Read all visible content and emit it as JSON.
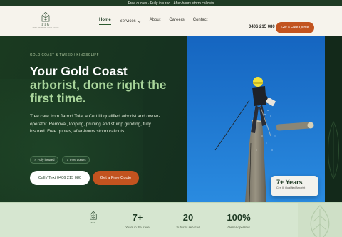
{
  "topbar": {
    "text": "Free quotes · Fully insured · After-hours storm callouts"
  },
  "brand": {
    "name": "TTG",
    "tagline": "TREE TRIMMING GOLD COAST",
    "icon": "tree-logo-icon"
  },
  "nav": {
    "items": [
      {
        "label": "Home",
        "active": true
      },
      {
        "label": "Services",
        "has_dropdown": true
      },
      {
        "label": "About"
      },
      {
        "label": "Careers"
      },
      {
        "label": "Contact"
      }
    ],
    "phone": "0406 215 080",
    "cta_label": "Get a Free Quote"
  },
  "hero": {
    "eyebrow": "GOLD COAST & TWEED / KINGSCLIFF",
    "headline_line1": "Your Gold Coast",
    "headline_accent": "arborist, done right the first time.",
    "lede": "Tree care from Jarrod Toia, a Cert III qualified arborist and owner-operator. Removal, lopping, pruning and stump grinding, fully insured. Free quotes, after-hours storm callouts.",
    "pills": [
      "✓ Fully insured",
      "✓ Free quotes"
    ],
    "call_button": "Call / Text 0406 215 080",
    "quote_button": "Get a Free Quote",
    "badge": {
      "value": "7+ Years",
      "label": "Cert III Qualified Arborist"
    }
  },
  "stats": {
    "logo_text": "TTG",
    "items": [
      {
        "value": "7+",
        "label": "Years in the trade"
      },
      {
        "value": "20",
        "label": "Suburbs serviced"
      },
      {
        "value": "100%",
        "label": "Owner-operated"
      }
    ]
  },
  "colors": {
    "brand_dark": "#1f3b24",
    "accent_orange": "#c2531f",
    "accent_green": "#a8d49a",
    "cream": "#f6f3ec",
    "sky": "#1f7fd1"
  }
}
